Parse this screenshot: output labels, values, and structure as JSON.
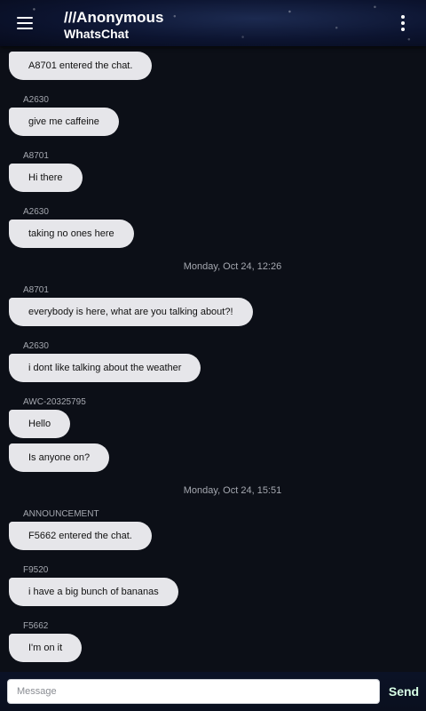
{
  "header": {
    "title": "///Anonymous",
    "subtitle": "WhatsChat",
    "menu_icon": "hamburger-menu-icon",
    "more_icon": "more-vertical-icon"
  },
  "messages": [
    {
      "kind": "message",
      "sender": "",
      "text": "A8701 entered the chat."
    },
    {
      "kind": "message",
      "sender": "A2630",
      "text": "give me caffeine"
    },
    {
      "kind": "message",
      "sender": "A8701",
      "text": "Hi there"
    },
    {
      "kind": "message",
      "sender": "A2630",
      "text": "taking no ones here"
    },
    {
      "kind": "date",
      "text": "Monday, Oct 24, 12:26"
    },
    {
      "kind": "message",
      "sender": "A8701",
      "text": "everybody is here, what are you talking about?!"
    },
    {
      "kind": "message",
      "sender": "A2630",
      "text": "i dont like talking about the weather"
    },
    {
      "kind": "message",
      "sender": "AWC-20325795",
      "text": "Hello"
    },
    {
      "kind": "message",
      "sender": "",
      "text": "Is anyone on?"
    },
    {
      "kind": "date",
      "text": "Monday, Oct 24, 15:51"
    },
    {
      "kind": "message",
      "sender": "ANNOUNCEMENT",
      "text": "F5662 entered the chat."
    },
    {
      "kind": "message",
      "sender": "F9520",
      "text": "i have a big bunch of bananas"
    },
    {
      "kind": "message",
      "sender": "F5662",
      "text": "I'm on it"
    }
  ],
  "composer": {
    "placeholder": "Message",
    "value": "",
    "send_label": "Send"
  }
}
